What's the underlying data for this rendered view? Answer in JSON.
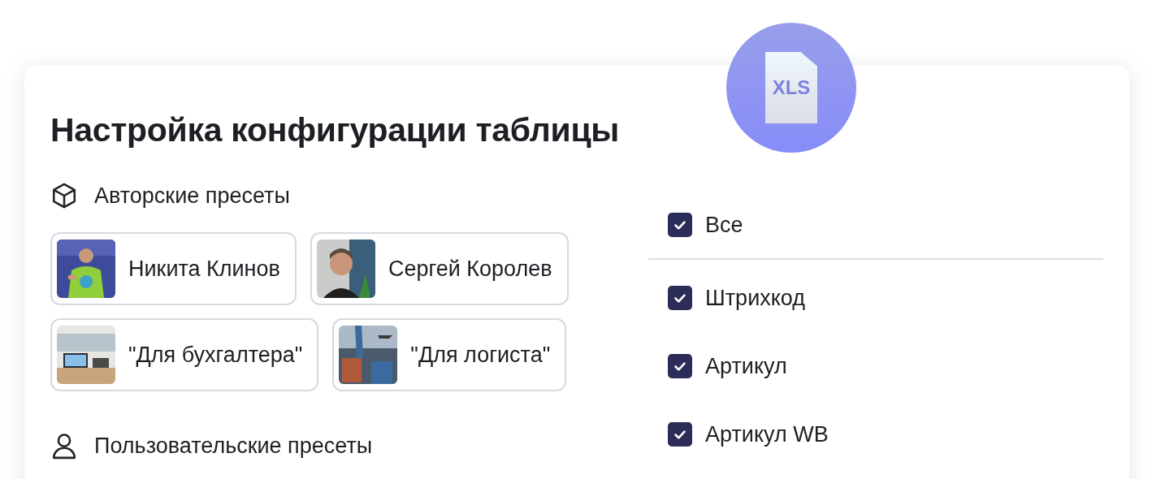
{
  "badge": {
    "label": "XLS"
  },
  "title": "Настройка конфигурации таблицы",
  "sections": [
    {
      "kind": "authors",
      "title": "Авторские пресеты",
      "presets": [
        {
          "label": "Никита Клинов"
        },
        {
          "label": "Сергей Королев"
        },
        {
          "label": "\"Для бухгалтера\""
        },
        {
          "label": "\"Для логиста\""
        }
      ]
    },
    {
      "kind": "users",
      "title": "Пользовательские пресеты"
    }
  ],
  "columns": {
    "all": {
      "label": "Все",
      "checked": true
    },
    "items": [
      {
        "label": "Штрихкод",
        "checked": true
      },
      {
        "label": "Артикул",
        "checked": true
      },
      {
        "label": "Артикул WB",
        "checked": true
      }
    ]
  }
}
